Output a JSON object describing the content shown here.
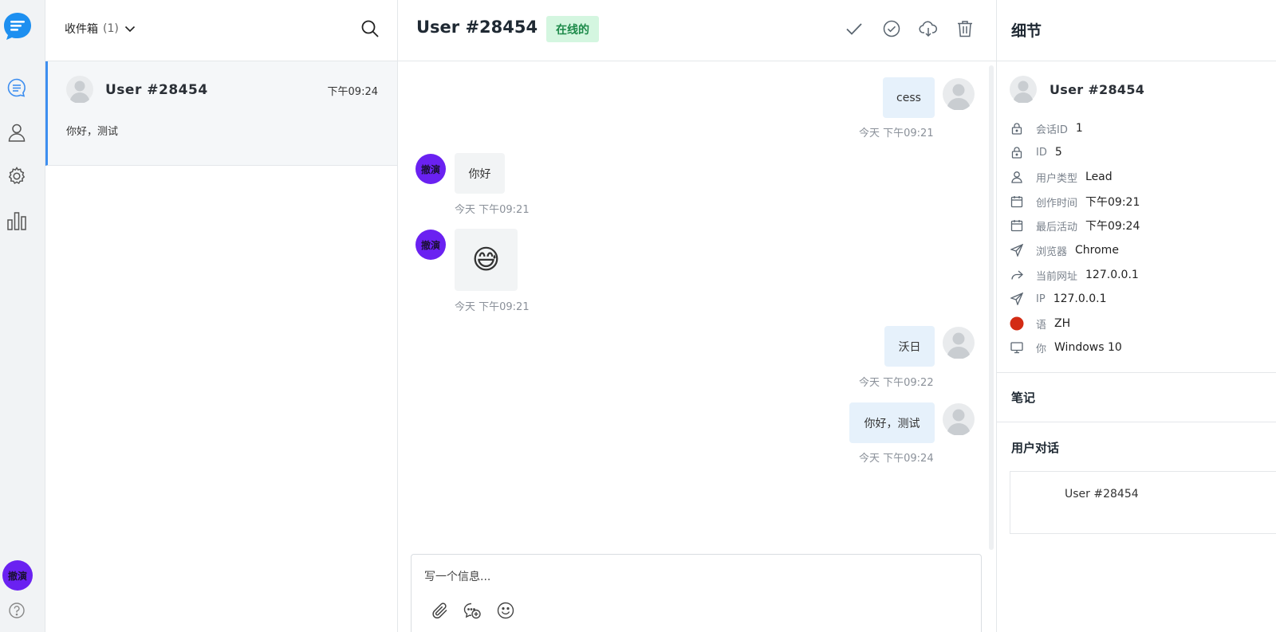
{
  "colors": {
    "accent": "#3d8ef0",
    "brand_avatar": "#6a21f1",
    "online_bg": "#d4f6e0",
    "online_text": "#1d8a4a",
    "flag": "#d32b14"
  },
  "rail": {
    "items": [
      "chat-icon",
      "user-icon",
      "gear-icon",
      "bar-chart-icon"
    ],
    "me_avatar": "撤演"
  },
  "list": {
    "inbox_label": "收件箱",
    "inbox_count": "(1)",
    "conversations": [
      {
        "name": "User #28454",
        "time": "下午09:24",
        "preview": "你好，测试"
      }
    ]
  },
  "chat": {
    "title": "User #28454",
    "status": "在线的",
    "agent_avatar": "撤演",
    "messages": [
      {
        "dir": "out",
        "text": "cess",
        "stamp": "今天 下午09:21"
      },
      {
        "dir": "in",
        "text": "你好",
        "stamp": "今天 下午09:21"
      },
      {
        "dir": "in",
        "text": "😅",
        "stamp": "今天 下午09:21"
      },
      {
        "dir": "out",
        "text": "沃日",
        "stamp": "今天 下午09:22"
      },
      {
        "dir": "out",
        "text": "你好，测试",
        "stamp": "今天 下午09:24"
      }
    ],
    "composer_placeholder": "写一个信息..."
  },
  "details": {
    "title": "细节",
    "user_name": "User #28454",
    "rows": [
      {
        "icon": "lock-icon",
        "label": "会话ID",
        "value": "1"
      },
      {
        "icon": "lock-icon",
        "label": "ID",
        "value": "5"
      },
      {
        "icon": "user-icon",
        "label": "用户类型",
        "value": "Lead"
      },
      {
        "icon": "calendar-icon",
        "label": "创作时间",
        "value": "下午09:21"
      },
      {
        "icon": "calendar-icon",
        "label": "最后活动",
        "value": "下午09:24"
      },
      {
        "icon": "send-icon",
        "label": "浏览器",
        "value": "Chrome"
      },
      {
        "icon": "share-icon",
        "label": "当前网址",
        "value": "127.0.0.1"
      },
      {
        "icon": "send-icon",
        "label": "IP",
        "value": "127.0.0.1"
      },
      {
        "icon": "flag-icon",
        "label": "语",
        "value": "ZH"
      },
      {
        "icon": "monitor-icon",
        "label": "你",
        "value": "Windows 10"
      }
    ],
    "notes_title": "笔记",
    "user_conversations_title": "用户对话",
    "user_conversation_item": "User #28454"
  }
}
